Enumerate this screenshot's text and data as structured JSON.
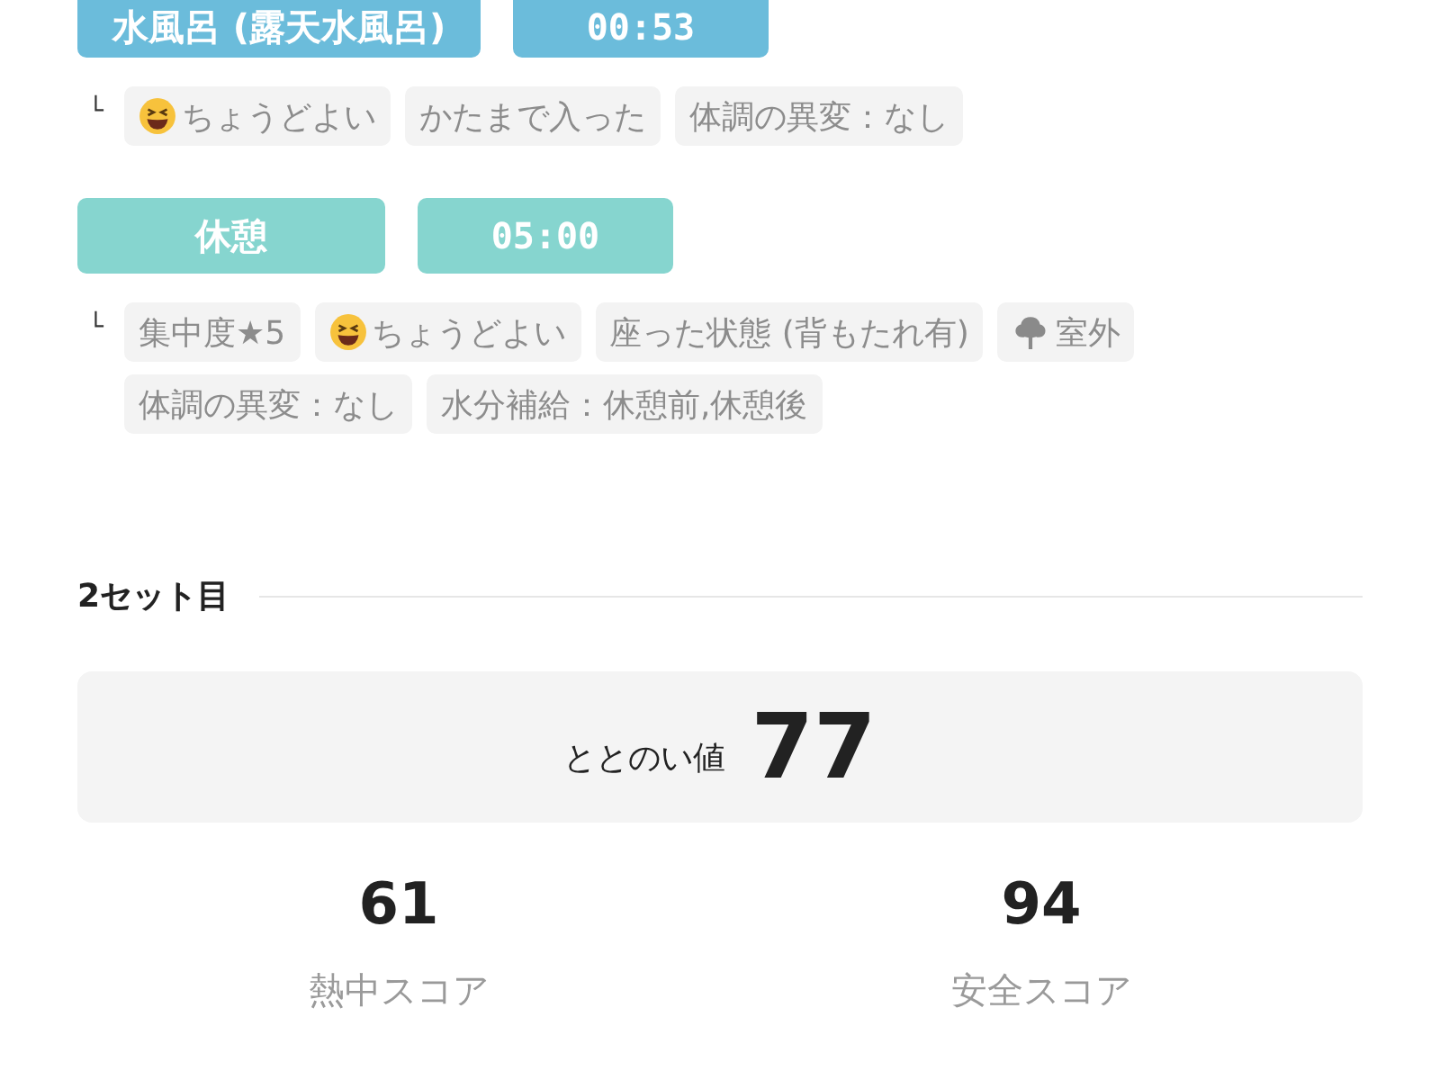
{
  "steps": [
    {
      "name": "水風呂 (露天水風呂)",
      "time": "00:53",
      "color": "#6bbcdb",
      "tags": [
        {
          "kind": "mood",
          "text": "ちょうどよい"
        },
        {
          "kind": "plain",
          "text": "かたまで入った"
        },
        {
          "kind": "plain",
          "text": "体調の異変：なし"
        }
      ]
    },
    {
      "name": "休憩",
      "time": "05:00",
      "color": "#86d5cf",
      "tags": [
        {
          "kind": "plain",
          "text": "集中度★5"
        },
        {
          "kind": "mood",
          "text": "ちょうどよい"
        },
        {
          "kind": "plain",
          "text": "座った状態 (背もたれ有)"
        },
        {
          "kind": "place",
          "text": "室外"
        },
        {
          "kind": "plain",
          "text": "体調の異変：なし"
        },
        {
          "kind": "plain",
          "text": "水分補給：休憩前,休憩後"
        }
      ]
    }
  ],
  "branch_mark": "└",
  "section": {
    "title": "2セット目",
    "total": {
      "label": "ととのい値",
      "value": "77"
    },
    "scores": [
      {
        "value": "61",
        "label": "熱中スコア"
      },
      {
        "value": "94",
        "label": "安全スコア"
      }
    ]
  }
}
